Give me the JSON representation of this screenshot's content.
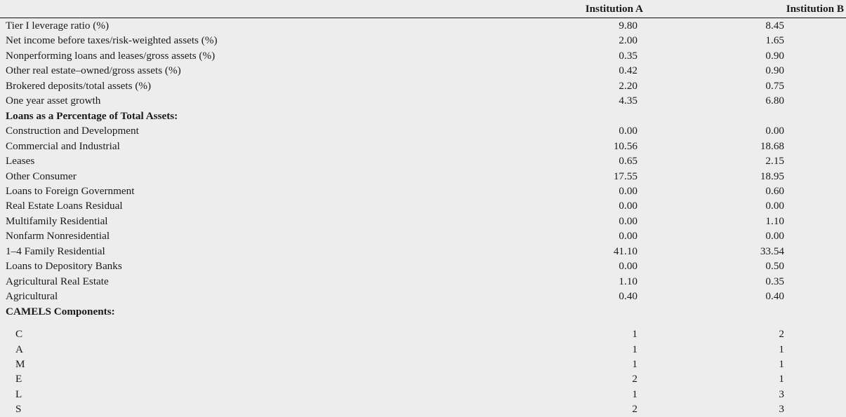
{
  "table": {
    "columns": [
      {
        "key": "label",
        "label": "",
        "align": "left"
      },
      {
        "key": "inst_a",
        "label": "Institution A",
        "align": "right"
      },
      {
        "key": "inst_b",
        "label": "Institution B",
        "align": "right"
      }
    ],
    "rows": [
      {
        "type": "data",
        "label": "Tier I leverage ratio (%)",
        "inst_a": "9.80",
        "inst_b": "8.45"
      },
      {
        "type": "data",
        "label": "Net income before taxes/risk-weighted assets (%)",
        "inst_a": "2.00",
        "inst_b": "1.65"
      },
      {
        "type": "data",
        "label": "Nonperforming loans and leases/gross assets (%)",
        "inst_a": "0.35",
        "inst_b": "0.90"
      },
      {
        "type": "data",
        "label": "Other real estate–owned/gross assets (%)",
        "inst_a": "0.42",
        "inst_b": "0.90"
      },
      {
        "type": "data",
        "label": "Brokered deposits/total assets (%)",
        "inst_a": "2.20",
        "inst_b": "0.75"
      },
      {
        "type": "data",
        "label": "One year asset growth",
        "inst_a": "4.35",
        "inst_b": "6.80"
      },
      {
        "type": "section",
        "label": "Loans as a Percentage of Total Assets:",
        "inst_a": "",
        "inst_b": ""
      },
      {
        "type": "data",
        "label": "Construction and Development",
        "inst_a": "0.00",
        "inst_b": "0.00"
      },
      {
        "type": "data",
        "label": "Commercial and Industrial",
        "inst_a": "10.56",
        "inst_b": "18.68"
      },
      {
        "type": "data",
        "label": "Leases",
        "inst_a": "0.65",
        "inst_b": "2.15"
      },
      {
        "type": "data",
        "label": "Other Consumer",
        "inst_a": "17.55",
        "inst_b": "18.95"
      },
      {
        "type": "data",
        "label": "Loans to Foreign Government",
        "inst_a": "0.00",
        "inst_b": "0.60"
      },
      {
        "type": "data",
        "label": "Real Estate Loans Residual",
        "inst_a": "0.00",
        "inst_b": "0.00"
      },
      {
        "type": "data",
        "label": "Multifamily Residential",
        "inst_a": "0.00",
        "inst_b": "1.10"
      },
      {
        "type": "data",
        "label": "Nonfarm Nonresidential",
        "inst_a": "0.00",
        "inst_b": "0.00"
      },
      {
        "type": "data",
        "label": "1–4 Family Residential",
        "inst_a": "41.10",
        "inst_b": "33.54"
      },
      {
        "type": "data",
        "label": "Loans to Depository Banks",
        "inst_a": "0.00",
        "inst_b": "0.50"
      },
      {
        "type": "data",
        "label": "Agricultural Real Estate",
        "inst_a": "1.10",
        "inst_b": "0.35"
      },
      {
        "type": "data",
        "label": "Agricultural",
        "inst_a": "0.40",
        "inst_b": "0.40"
      },
      {
        "type": "section",
        "label": "CAMELS Components:",
        "inst_a": "",
        "inst_b": ""
      },
      {
        "type": "spacer",
        "label": "",
        "inst_a": "",
        "inst_b": ""
      },
      {
        "type": "indent",
        "label": "C",
        "inst_a": "1",
        "inst_b": "2"
      },
      {
        "type": "indent",
        "label": "A",
        "inst_a": "1",
        "inst_b": "1"
      },
      {
        "type": "indent",
        "label": "M",
        "inst_a": "1",
        "inst_b": "1"
      },
      {
        "type": "indent",
        "label": "E",
        "inst_a": "2",
        "inst_b": "1"
      },
      {
        "type": "indent",
        "label": "L",
        "inst_a": "1",
        "inst_b": "3"
      },
      {
        "type": "indent",
        "label": "S",
        "inst_a": "2",
        "inst_b": "3"
      }
    ]
  },
  "style": {
    "background": "#ededee",
    "rule_color": "#111111",
    "text_color": "#1a1a1a"
  }
}
